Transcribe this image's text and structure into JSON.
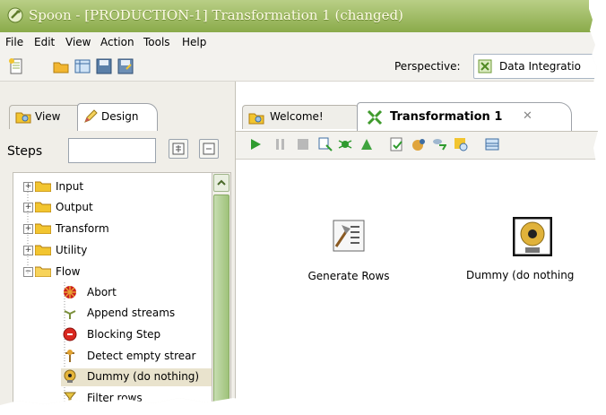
{
  "window": {
    "title": "Spoon - [PRODUCTION-1] Transformation 1 (changed)"
  },
  "menubar": {
    "items": [
      "File",
      "Edit",
      "View",
      "Action",
      "Tools",
      "Help"
    ]
  },
  "toolbar": {
    "icons": [
      "new-file-icon",
      "open-folder-icon",
      "explore-repository-icon",
      "save-icon",
      "save-as-icon"
    ],
    "perspective_label": "Perspective:",
    "perspective_value": "Data Integratio"
  },
  "left_panel": {
    "tabs": [
      {
        "label": "View",
        "icon": "view-icon",
        "active": false
      },
      {
        "label": "Design",
        "icon": "pencil-icon",
        "active": true
      }
    ],
    "steps_label": "Steps",
    "search_placeholder": "",
    "tree": [
      {
        "label": "Input",
        "type": "folder",
        "expanded": false
      },
      {
        "label": "Output",
        "type": "folder",
        "expanded": false
      },
      {
        "label": "Transform",
        "type": "folder",
        "expanded": false
      },
      {
        "label": "Utility",
        "type": "folder",
        "expanded": false
      },
      {
        "label": "Flow",
        "type": "folder",
        "expanded": true
      },
      {
        "label": "Abort",
        "type": "step",
        "icon": "abort-icon"
      },
      {
        "label": "Append streams",
        "type": "step",
        "icon": "append-streams-icon"
      },
      {
        "label": "Blocking Step",
        "type": "step",
        "icon": "blocking-step-icon"
      },
      {
        "label": "Detect empty strear",
        "type": "step",
        "icon": "detect-empty-stream-icon"
      },
      {
        "label": "Dummy (do nothing)",
        "type": "step",
        "icon": "dummy-icon",
        "selected": true
      },
      {
        "label": "Filter rows",
        "type": "step",
        "icon": "filter-rows-icon"
      }
    ]
  },
  "right_panel": {
    "tabs": [
      {
        "label": "Welcome!",
        "icon": "welcome-icon",
        "active": false
      },
      {
        "label": "Transformation 1",
        "icon": "transformation-icon",
        "active": true,
        "closable": true
      }
    ],
    "toolbar_icons": [
      "run-icon",
      "pause-icon",
      "stop-icon",
      "preview-icon",
      "debug-icon",
      "replay-icon",
      "verify-icon",
      "impact-icon",
      "sql-icon",
      "explore-db-icon",
      "show-results-icon"
    ],
    "canvas_steps": [
      {
        "label": "Generate Rows",
        "icon": "generate-rows-icon"
      },
      {
        "label": "Dummy (do nothing",
        "icon": "dummy-icon"
      }
    ]
  },
  "colors": {
    "titlebar": "#9ab55a",
    "active_tab_text": "#000000",
    "selection": "#e9e3cd",
    "folder": "#f2c530"
  }
}
